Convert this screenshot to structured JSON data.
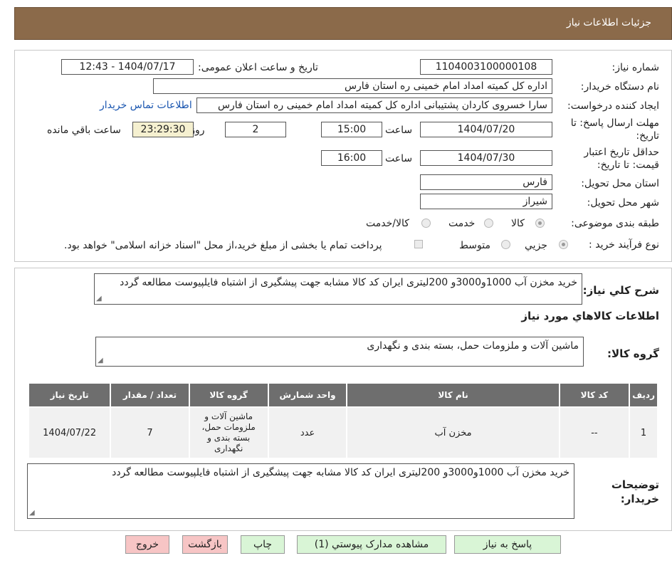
{
  "header": {
    "title": "جزئیات اطلاعات نیاز"
  },
  "watermark": {
    "text": "AriaTender.neT"
  },
  "form": {
    "need_number_label": "شماره نیاز:",
    "need_number": "1104003100000108",
    "announce_label": "تاریخ و ساعت اعلان عمومی:",
    "announce_value": "1404/07/17 - 12:43",
    "buyer_org_label": "نام دستگاه خریدار:",
    "buyer_org": "اداره کل کمیته امداد امام خمینی  ره  استان فارس",
    "creator_label": "ایجاد کننده درخواست:",
    "creator": "سارا خسروی کاردان پشتیبانی  اداره کل کمیته امداد امام خمینی  ره  استان فارس",
    "contact_link": "اطلاعات تماس خریدار",
    "reply_deadline_label_1": "مهلت ارسال پاسخ: تا",
    "reply_deadline_label_2": "تاریخ:",
    "reply_date": "1404/07/20",
    "time_label": "ساعت",
    "reply_time": "15:00",
    "days_value": "2",
    "days_label": "روز و",
    "remaining_time": "23:29:30",
    "remaining_label": "ساعت باقي مانده",
    "validity_label_1": "حداقل تاریخ اعتبار",
    "validity_label_2": "قیمت: تا تاریخ:",
    "validity_date": "1404/07/30",
    "validity_time_label": "ساعت",
    "validity_time": "16:00",
    "province_label": "استان محل تحویل:",
    "province": "فارس",
    "city_label": "شهر محل تحویل:",
    "city": "شیراز",
    "category_label": "طبقه بندی موضوعی:",
    "category_options": [
      "کالا",
      "خدمت",
      "کالا/خدمت"
    ],
    "category_selected": "کالا",
    "process_label": "نوع فرآیند خرید :",
    "process_options": [
      "جزیي",
      "متوسط"
    ],
    "process_selected": "جزیي",
    "payment_note": "پرداخت تمام یا بخشی از مبلغ خرید،از محل \"اسناد خزانه اسلامی\" خواهد بود."
  },
  "summary": {
    "desc_label": "شرح کلي نياز:",
    "desc_value": "خرید مخزن آب 1000و3000و 200لیتری ایران کد کالا مشابه جهت پیشگیری از اشتباه فایلپیوست مطالعه گردد",
    "goods_info_title": "اطلاعات کالاهاي مورد نياز",
    "goods_group_label": "گروه کالا:",
    "goods_group_value": "ماشین آلات و ملزومات حمل، بسته بندی و نگهداری"
  },
  "table": {
    "headers": [
      "ردیف",
      "کد کالا",
      "نام کالا",
      "واحد شمارش",
      "گروه کالا",
      "تعداد / مقدار",
      "تاریخ نیاز"
    ],
    "rows": [
      [
        "1",
        "--",
        "مخزن آب",
        "عدد",
        "ماشین آلات و ملزومات حمل، بسته بندی و نگهداری",
        "7",
        "1404/07/22"
      ]
    ]
  },
  "buyer_notes": {
    "label_1": "توضیحات",
    "label_2": "خریدار:",
    "value": "خرید مخزن آب 1000و3000و 200لیتری ایران کد کالا مشابه جهت پیشگیری از اشتباه فایلپیوست مطالعه گردد"
  },
  "buttons": {
    "reply": "پاسخ به نیاز",
    "attachments": "مشاهده مدارک پیوستي (1)",
    "print": "چاپ",
    "back": "بازگشت",
    "exit": "خروج"
  }
}
